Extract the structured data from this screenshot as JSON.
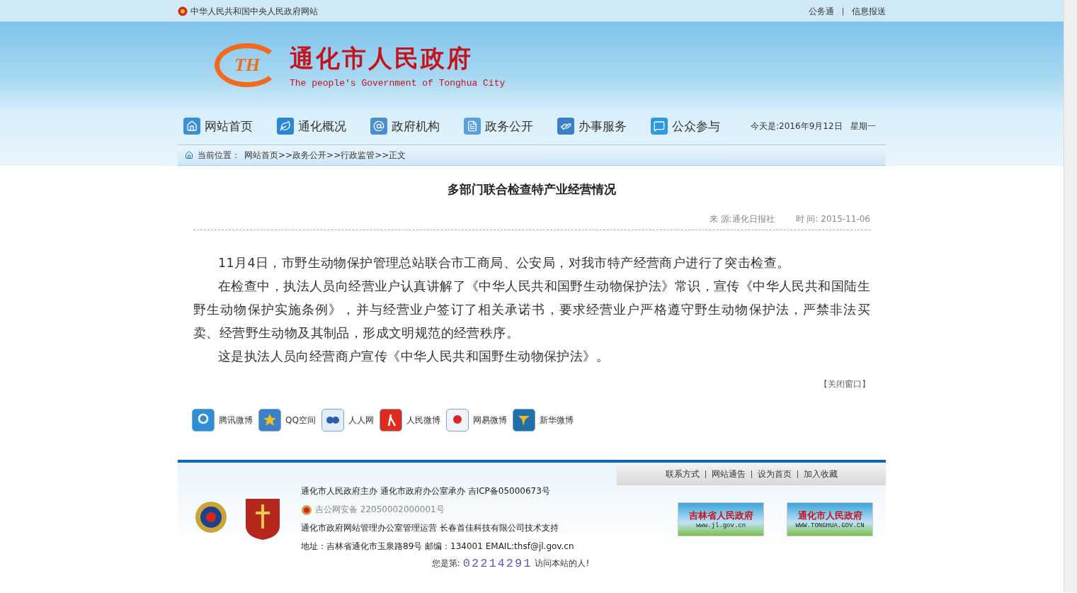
{
  "top_bar": {
    "site_link": "中华人民共和国中央人民政府网站",
    "links": [
      "公务通",
      "信息报送"
    ]
  },
  "header": {
    "logo_text": "TH",
    "title": "通化市人民政府",
    "subtitle": "The people's Government of Tonghua City"
  },
  "nav": {
    "items": [
      {
        "label": "网站首页",
        "kind": "home"
      },
      {
        "label": "通化概况",
        "kind": "leaf"
      },
      {
        "label": "政府机构",
        "kind": "at"
      },
      {
        "label": "政务公开",
        "kind": "doc"
      },
      {
        "label": "办事服务",
        "kind": "hand"
      },
      {
        "label": "公众参与",
        "kind": "chat"
      }
    ],
    "date": "今天是:2016年9月12日",
    "weekday": "星期一"
  },
  "breadcrumb": {
    "label": "当前位置：",
    "path": "网站首页>>政务公开>>行政监管>>正文"
  },
  "article": {
    "title": "多部门联合检查特产业经营情况",
    "source": "来 源:通化日报社",
    "time": "时 间: 2015-11-06",
    "paragraphs": [
      "11月4日，市野生动物保护管理总站联合市工商局、公安局，对我市特产经营商户进行了突击检查。",
      "在检查中，执法人员向经营业户认真讲解了《中华人民共和国野生动物保护法》常识，宣传《中华人民共和国陆生野生动物保护实施条例》，并与经营业户签订了相关承诺书，要求经营业户严格遵守野生动物保护法，严禁非法买卖、经营野生动物及其制品，形成文明规范的经营秩序。",
      "这是执法人员向经营商户宣传《中华人民共和国野生动物保护法》。"
    ],
    "close_link": "【关闭窗口】"
  },
  "share": [
    {
      "label": "腾讯微博",
      "kind": "tencent"
    },
    {
      "label": "QQ空间",
      "kind": "qzone"
    },
    {
      "label": "人人网",
      "kind": "renren"
    },
    {
      "label": "人民微博",
      "kind": "people"
    },
    {
      "label": "网易微博",
      "kind": "netease"
    },
    {
      "label": "新华微博",
      "kind": "xinhua"
    }
  ],
  "footer": {
    "links": [
      "联系方式",
      "网站通告",
      "设为首页",
      "加入收藏"
    ],
    "lines": [
      {
        "kind": "plain",
        "text": "通化市人民政府主办 通化市政府办公室承办 吉ICP备05000673号"
      },
      {
        "kind": "police",
        "text": "吉公网安备 22050002000001号"
      },
      {
        "kind": "plain",
        "text": "通化市政府网站管理办公室管理运营 长春首佳科技有限公司技术支持"
      },
      {
        "kind": "plain",
        "text": "地址：吉林省通化市玉泉路89号 邮编：134001 EMAIL:thsf@jl.gov.cn"
      }
    ],
    "badges": [
      {
        "title": "吉林省人民政府",
        "url": "www.jl.gov.cn"
      },
      {
        "title": "通化市人民政府",
        "url": "WWW.TONGHUA.GOV.CN"
      }
    ],
    "visitor": {
      "prefix": "您是第:",
      "count": "02214291",
      "suffix": "访问本站的人!"
    }
  }
}
